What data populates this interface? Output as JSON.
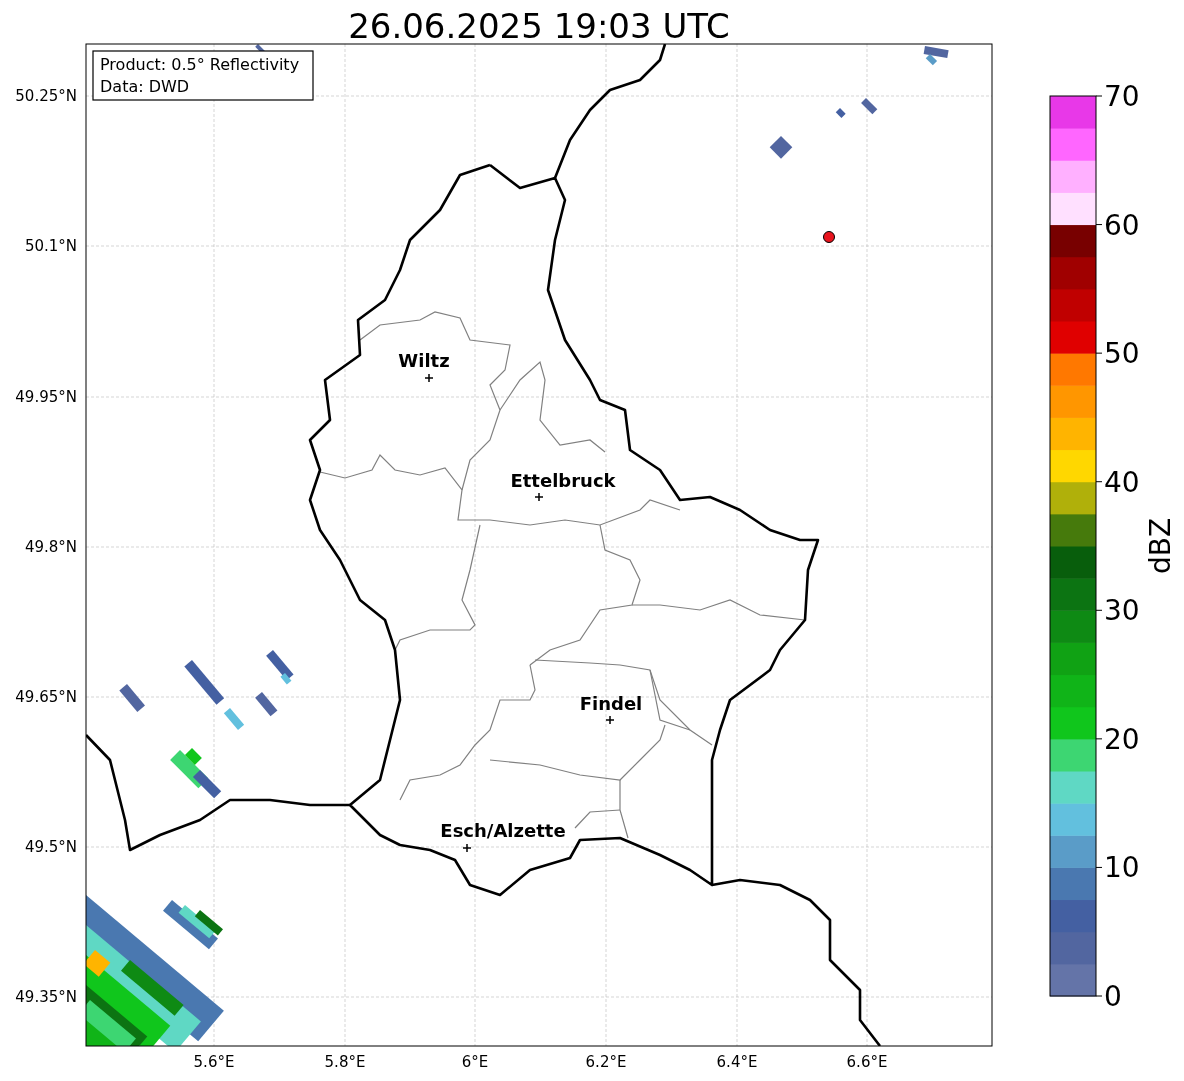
{
  "title": "26.06.2025 19:03 UTC",
  "info_box": {
    "lines": [
      "Product: 0.5° Reflectivity",
      "Data: DWD"
    ]
  },
  "cities": [
    {
      "name": "Wiltz"
    },
    {
      "name": "Ettelbruck"
    },
    {
      "name": "Findel"
    },
    {
      "name": "Esch/Alzette"
    }
  ],
  "x_axis": {
    "ticks": [
      "5.6°E",
      "5.8°E",
      "6°E",
      "6.2°E",
      "6.4°E",
      "6.6°E"
    ]
  },
  "y_axis": {
    "ticks": [
      "50.25°N",
      "50.1°N",
      "49.95°N",
      "49.8°N",
      "49.65°N",
      "49.5°N",
      "49.35°N"
    ]
  },
  "colorbar": {
    "label": "dBZ",
    "ticks": [
      "70",
      "60",
      "50",
      "40",
      "30",
      "20",
      "10",
      "0"
    ],
    "bins": [
      {
        "color": "#6474a8"
      },
      {
        "color": "#5266a0"
      },
      {
        "color": "#4460a2"
      },
      {
        "color": "#4a78b0"
      },
      {
        "color": "#5a9cc8"
      },
      {
        "color": "#62c0de"
      },
      {
        "color": "#5fd8c4"
      },
      {
        "color": "#3dd672"
      },
      {
        "color": "#10c61c"
      },
      {
        "color": "#10b418"
      },
      {
        "color": "#10a214"
      },
      {
        "color": "#0e8a14"
      },
      {
        "color": "#0c7412"
      },
      {
        "color": "#085e0c"
      },
      {
        "color": "#467a0c"
      },
      {
        "color": "#b0b00a"
      },
      {
        "color": "#ffd700"
      },
      {
        "color": "#ffb400"
      },
      {
        "color": "#ff9600"
      },
      {
        "color": "#ff7800"
      },
      {
        "color": "#e00000"
      },
      {
        "color": "#c00000"
      },
      {
        "color": "#a00000"
      },
      {
        "color": "#780000"
      },
      {
        "color": "#ffe0ff"
      },
      {
        "color": "#ffb0ff"
      },
      {
        "color": "#ff66ff"
      },
      {
        "color": "#e838e8"
      }
    ]
  }
}
